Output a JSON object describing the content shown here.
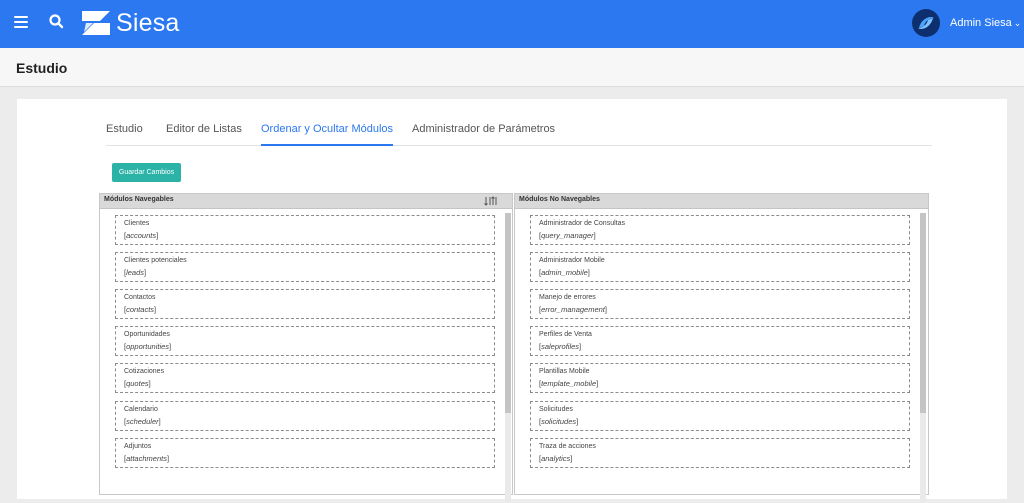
{
  "header": {
    "brand": "Siesa",
    "user_name": "Admin Siesa",
    "colors": {
      "bar": "#2b78f0",
      "accent": "#2cb3a8"
    }
  },
  "page": {
    "title": "Estudio"
  },
  "tabs": [
    {
      "label": "Estudio",
      "active": false
    },
    {
      "label": "Editor de Listas",
      "active": false
    },
    {
      "label": "Ordenar y Ocultar Módulos",
      "active": true
    },
    {
      "label": "Administrador de Parámetros",
      "active": false
    }
  ],
  "save_button": {
    "label": "Guardar Cambios"
  },
  "navigable": {
    "title": "Módulos Navegables",
    "items": [
      {
        "label": "Clientes",
        "key": "accounts"
      },
      {
        "label": "Clientes potenciales",
        "key": "leads"
      },
      {
        "label": "Contactos",
        "key": "contacts"
      },
      {
        "label": "Oportunidades",
        "key": "opportunities"
      },
      {
        "label": "Cotizaciones",
        "key": "quotes"
      },
      {
        "label": "Calendario",
        "key": "scheduler"
      },
      {
        "label": "Adjuntos",
        "key": "attachments"
      }
    ]
  },
  "non_navigable": {
    "title": "Módulos No Navegables",
    "items": [
      {
        "label": "Administrador de Consultas",
        "key": "query_manager"
      },
      {
        "label": "Administrador Mobile",
        "key": "admin_mobile"
      },
      {
        "label": "Manejo de errores",
        "key": "error_management"
      },
      {
        "label": "Perfiles de Venta",
        "key": "saleprofiles"
      },
      {
        "label": "Plantillas Mobile",
        "key": "template_mobile"
      },
      {
        "label": "Solicitudes",
        "key": "solicitudes"
      },
      {
        "label": "Traza de acciones",
        "key": "analytics"
      }
    ]
  }
}
